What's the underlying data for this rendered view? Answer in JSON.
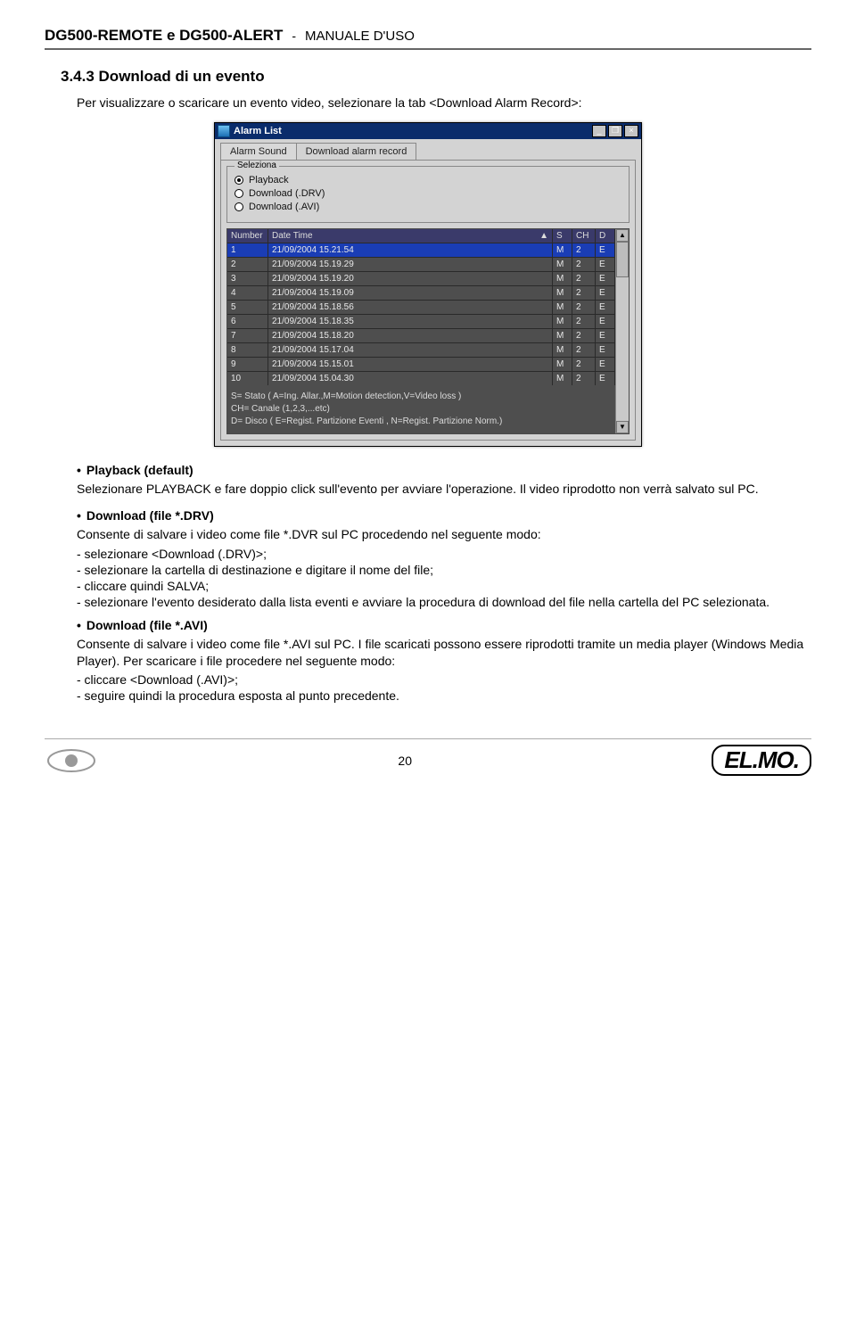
{
  "doc": {
    "header_title": "DG500-REMOTE e DG500-ALERT",
    "header_sep": "-",
    "header_sub": "MANUALE D'USO",
    "section_no_title": "3.4.3 Download di un evento",
    "intro": "Per visualizzare o scaricare un evento video, selezionare la tab <Download Alarm Record>:",
    "bullet1": "Playback (default)",
    "para1": "Selezionare PLAYBACK e fare doppio click sull'evento per avviare l'operazione. Il video riprodotto non verrà salvato sul PC.",
    "bullet2": "Download (file *.DRV)",
    "para2": "Consente di salvare i video come file *.DVR sul PC procedendo nel seguente modo:",
    "sub2": {
      "a": "-  selezionare <Download (.DRV)>;",
      "b": "-  selezionare la cartella di destinazione e digitare il nome del file;",
      "c": "-  cliccare quindi SALVA;",
      "d": "-  selezionare l'evento desiderato dalla lista eventi e avviare la procedura di download del file nella cartella del PC selezionata."
    },
    "bullet3": "Download (file *.AVI)",
    "para3": "Consente di salvare i video come file *.AVI sul PC. I file scaricati possono essere riprodotti tramite un media player (Windows Media Player). Per scaricare i file procedere nel seguente modo:",
    "sub3": {
      "a": "-  cliccare <Download (.AVI)>;",
      "b": "-  seguire quindi la procedura esposta al punto precedente."
    },
    "page_number": "20",
    "logo": "EL.MO."
  },
  "win": {
    "title": "Alarm List",
    "min": "_",
    "restore": "❐",
    "close": "×",
    "tab1": "Alarm Sound",
    "tab2": "Download alarm record",
    "group_legend": "Seleziona",
    "opt_playback": "Playback",
    "opt_drv": "Download (.DRV)",
    "opt_avi": "Download (.AVI)",
    "col_number": "Number",
    "col_date": "Date Time",
    "col_s": "S",
    "col_ch": "CH",
    "col_d": "D",
    "rows": [
      {
        "n": "1",
        "dt": "21/09/2004 15.21.54",
        "s": "M",
        "ch": "2",
        "d": "E"
      },
      {
        "n": "2",
        "dt": "21/09/2004 15.19.29",
        "s": "M",
        "ch": "2",
        "d": "E"
      },
      {
        "n": "3",
        "dt": "21/09/2004 15.19.20",
        "s": "M",
        "ch": "2",
        "d": "E"
      },
      {
        "n": "4",
        "dt": "21/09/2004 15.19.09",
        "s": "M",
        "ch": "2",
        "d": "E"
      },
      {
        "n": "5",
        "dt": "21/09/2004 15.18.56",
        "s": "M",
        "ch": "2",
        "d": "E"
      },
      {
        "n": "6",
        "dt": "21/09/2004 15.18.35",
        "s": "M",
        "ch": "2",
        "d": "E"
      },
      {
        "n": "7",
        "dt": "21/09/2004 15.18.20",
        "s": "M",
        "ch": "2",
        "d": "E"
      },
      {
        "n": "8",
        "dt": "21/09/2004 15.17.04",
        "s": "M",
        "ch": "2",
        "d": "E"
      },
      {
        "n": "9",
        "dt": "21/09/2004 15.15.01",
        "s": "M",
        "ch": "2",
        "d": "E"
      },
      {
        "n": "10",
        "dt": "21/09/2004 15.04.30",
        "s": "M",
        "ch": "2",
        "d": "E"
      }
    ],
    "note_s": "S= Stato ( A=Ing. Allar.,M=Motion detection,V=Video loss )",
    "note_ch": "CH= Canale (1,2,3,...etc)",
    "note_d": "D= Disco ( E=Regist. Partizione Eventi , N=Regist. Partizione Norm.)"
  }
}
